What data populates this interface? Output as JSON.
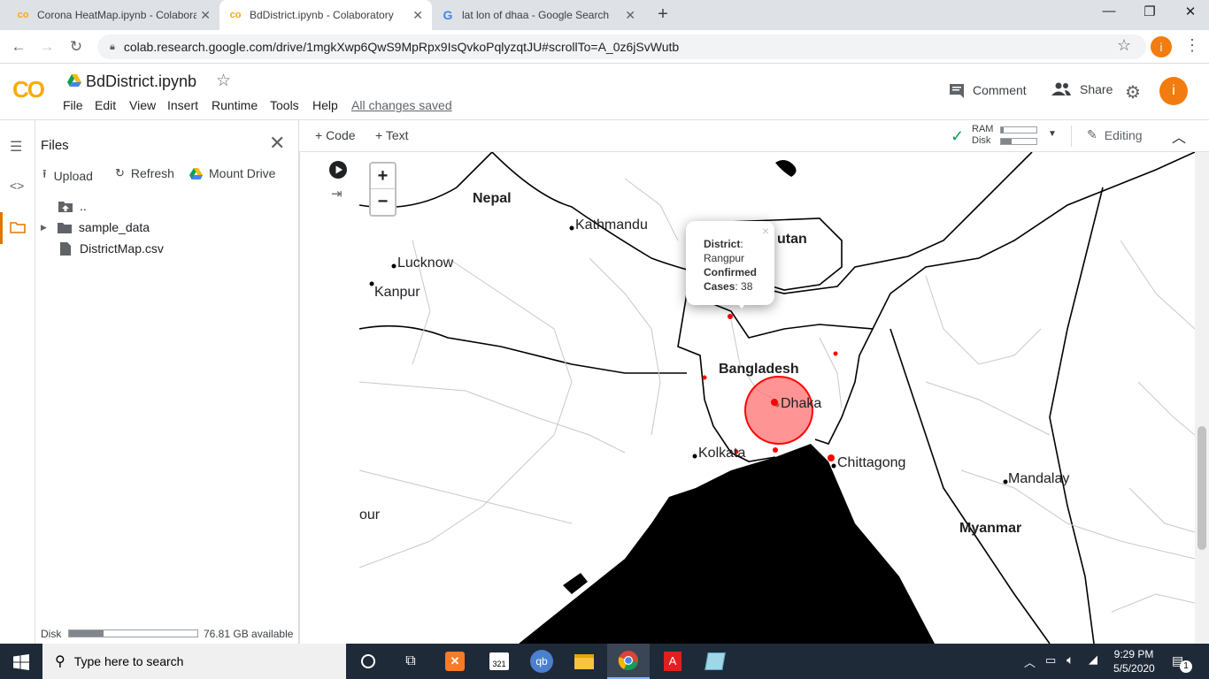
{
  "browser": {
    "tabs": [
      {
        "title": "Corona HeatMap.ipynb - Colabora",
        "favicon": "colab-icon"
      },
      {
        "title": "BdDistrict.ipynb - Colaboratory",
        "favicon": "colab-icon"
      },
      {
        "title": "lat lon of dhaa - Google Search",
        "favicon": "google-icon"
      }
    ],
    "new_tab": "+",
    "url": "colab.research.google.com/drive/1mgkXwp6QwS9MpRpx9IsQvkoPqlyzqtJU#scrollTo=A_0z6jSvWutb",
    "profile_initial": "i"
  },
  "colab": {
    "logo": "CO",
    "notebook_title": "BdDistrict.ipynb",
    "menu": [
      "File",
      "Edit",
      "View",
      "Insert",
      "Runtime",
      "Tools",
      "Help"
    ],
    "save_status": "All changes saved",
    "comment_label": "Comment",
    "share_label": "Share",
    "profile_initial": "i"
  },
  "toolbar": {
    "add_code": "+ Code",
    "add_text": "+ Text",
    "ram_label": "RAM",
    "disk_label": "Disk",
    "editing_label": "Editing"
  },
  "files_panel": {
    "title": "Files",
    "upload_label": "Upload",
    "refresh_label": "Refresh",
    "mount_label": "Mount Drive",
    "items": [
      {
        "name": "..",
        "type": "parent"
      },
      {
        "name": "sample_data",
        "type": "folder"
      },
      {
        "name": "DistrictMap.csv",
        "type": "file"
      }
    ],
    "disk_label": "Disk",
    "disk_available": "76.81 GB available",
    "disk_used_fraction": 0.27
  },
  "map": {
    "zoom_in": "+",
    "zoom_out": "−",
    "labels": {
      "nepal": "Nepal",
      "bhutan": "utan",
      "bangladesh": "Bangladesh",
      "myanmar": "Myanmar",
      "kathmandu": "Kathmandu",
      "lucknow": "Lucknow",
      "kanpur": "Kanpur",
      "kolkata": "Kolkata",
      "dhaka": "Dhaka",
      "chittagong": "Chittagong",
      "mandalay": "Mandalay",
      "partial": "our"
    },
    "popup": {
      "district_key": "District",
      "district_value": "Rangpur",
      "confirmed_key": "Confirmed",
      "cases_key": "Cases",
      "cases_value": "38",
      "close": "×"
    },
    "circle_color": "#ff0000"
  },
  "taskbar": {
    "search_placeholder": "Type here to search",
    "time": "9:29 PM",
    "date": "5/5/2020",
    "notification_count": "1"
  }
}
